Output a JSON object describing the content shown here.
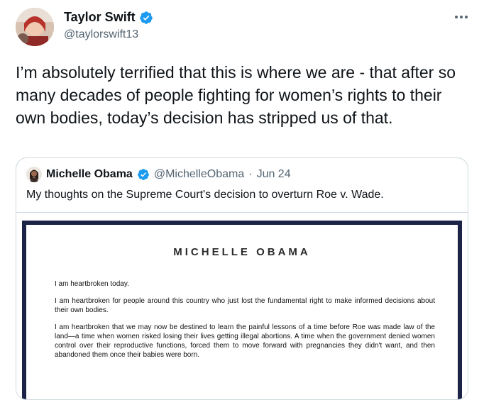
{
  "author": {
    "name": "Taylor Swift",
    "handle": "@taylorswift13",
    "verified": true,
    "avatar_icon": "profile-photo"
  },
  "more_icon": "more-dots-icon",
  "tweet_text": "I’m absolutely terrified that this is where we are - that after so many decades of people fighting for women’s rights to their own bodies, today’s decision has stripped us of that.",
  "quoted": {
    "name": "Michelle Obama",
    "handle": "@MichelleObama",
    "separator": "·",
    "date": "Jun 24",
    "verified": true,
    "text": "My thoughts on the Supreme Court's decision to overturn Roe v. Wade.",
    "letter": {
      "heading": "MICHELLE OBAMA",
      "paragraphs": [
        "I am heartbroken today.",
        "I am heartbroken for people around this country who just lost the fundamental right to make informed decisions about their own bodies.",
        "I am heartbroken that we may now be destined to learn the painful lessons of a time before Roe was made law of the land—a time when women risked losing their lives getting illegal abortions. A time when the government denied women control over their reproductive functions, forced them to move forward with pregnancies they didn't want, and then abandoned them once their babies were born."
      ]
    }
  },
  "colors": {
    "verified_blue": "#1d9bf0",
    "text_primary": "#0f1419",
    "text_secondary": "#536471",
    "border": "#cfd9de",
    "letter_frame": "#1b2347"
  }
}
